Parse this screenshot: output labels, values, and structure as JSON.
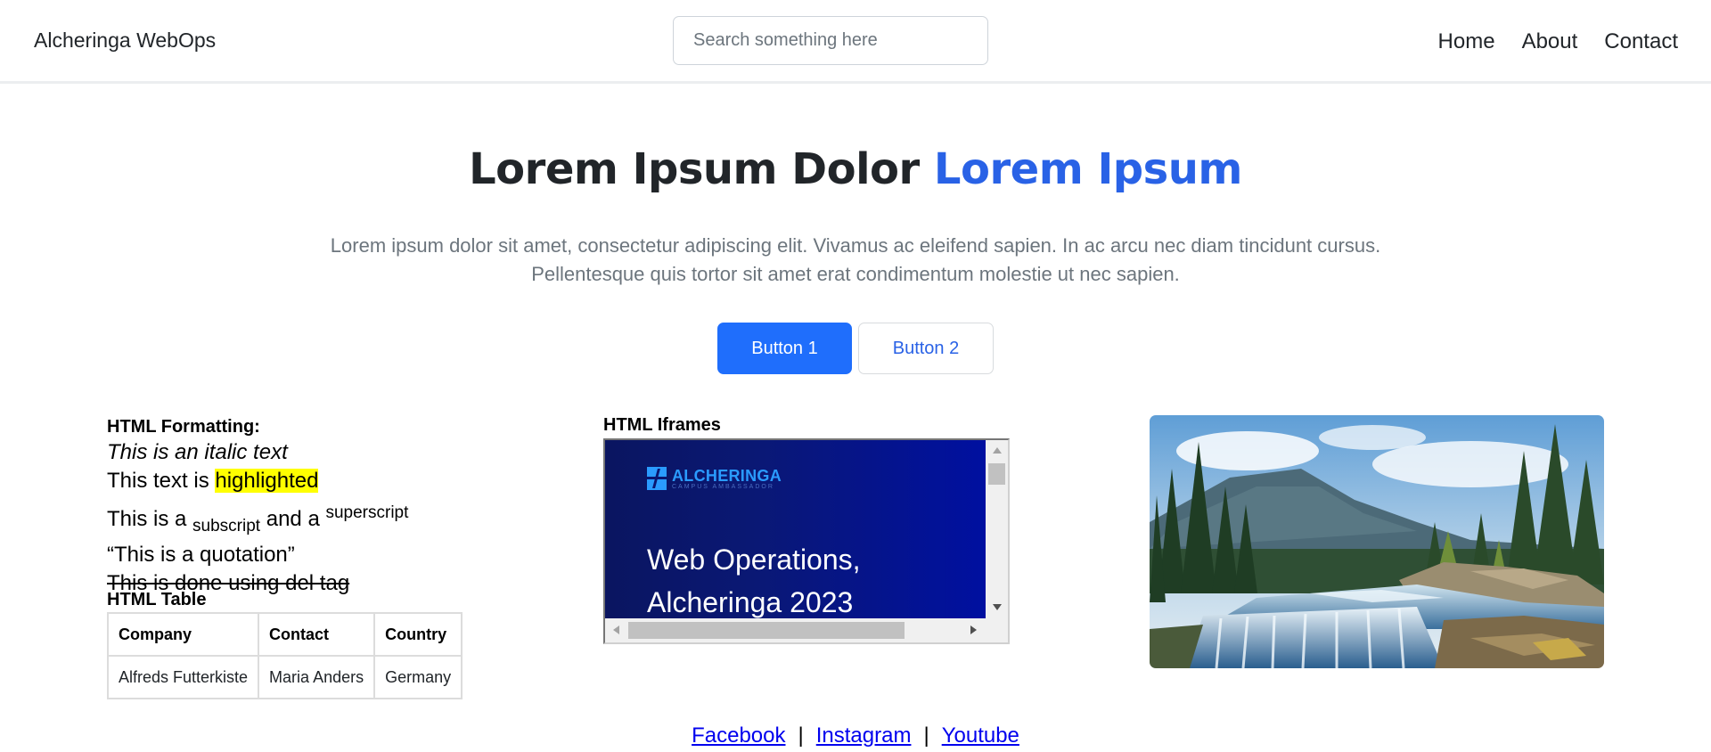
{
  "header": {
    "brand": "Alcheringa WebOps",
    "search_placeholder": "Search something here",
    "nav": [
      "Home",
      "About",
      "Contact"
    ]
  },
  "hero": {
    "title_main": "Lorem Ipsum Dolor",
    "title_accent": "Lorem Ipsum",
    "lead_line1": "Lorem ipsum dolor sit amet, consectetur adipiscing elit. Vivamus ac eleifend sapien. In ac arcu nec diam tincidunt cursus.",
    "lead_line2": "Pellentesque quis tortor sit amet erat condimentum molestie ut nec sapien.",
    "button1": "Button 1",
    "button2": "Button 2"
  },
  "formatting": {
    "heading": "HTML Formatting:",
    "italic": "This is an italic text",
    "highlight_prefix": "This text is ",
    "highlight_word": "highlighted",
    "sub_prefix": "This is a ",
    "sub_word": "subscript",
    "sub_mid": " and a ",
    "sup_word": "superscript",
    "quotation": "This is a quotation",
    "deleted": "This is done using del tag"
  },
  "table": {
    "heading": "HTML Table",
    "columns": [
      "Company",
      "Contact",
      "Country"
    ],
    "rows": [
      [
        "Alfreds Futterkiste",
        "Maria Anders",
        "Germany"
      ]
    ]
  },
  "iframe": {
    "heading": "HTML Iframes",
    "logo_main": "ALCHERINGA",
    "logo_sub": "CAMPUS AMBASSADOR",
    "content_line1": "Web Operations,",
    "content_line2": "Alcheringa 2023"
  },
  "footer": {
    "links": [
      "Facebook",
      "Instagram",
      "Youtube"
    ],
    "separator": "|"
  },
  "colors": {
    "accent": "#2962e6",
    "primary_button": "#1f6efc",
    "highlight": "#ffff00",
    "link": "#0000ee"
  }
}
